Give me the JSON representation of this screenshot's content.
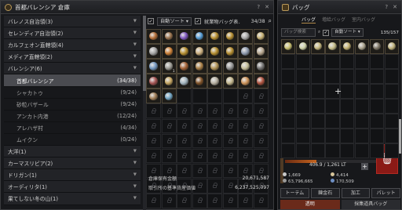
{
  "storage": {
    "title": "首都バレンシア 倉庫",
    "regions": [
      {
        "name": "バレノス自治領(3)",
        "type": "group"
      },
      {
        "name": "セレンディア自治領(2)",
        "type": "group"
      },
      {
        "name": "カルフェオン直轄領(4)",
        "type": "group"
      },
      {
        "name": "メディア直轄領(2)",
        "type": "group"
      },
      {
        "name": "バレンシア(6)",
        "type": "group"
      },
      {
        "name": "首都バレンシア",
        "count": "(34/38)",
        "type": "sub",
        "selected": true
      },
      {
        "name": "シャカトゥ",
        "count": "(9/24)",
        "type": "sub"
      },
      {
        "name": "砂粒バザール",
        "count": "(9/24)",
        "type": "sub"
      },
      {
        "name": "アンカト内港",
        "count": "(12/24)",
        "type": "sub"
      },
      {
        "name": "アレハザ村",
        "count": "(4/34)",
        "type": "sub"
      },
      {
        "name": "ムイクン",
        "count": "(0/24)",
        "type": "sub"
      },
      {
        "name": "大洋(1)",
        "type": "group"
      },
      {
        "name": "カーマスリビア(2)",
        "type": "group"
      },
      {
        "name": "ドリガン(1)",
        "type": "group"
      },
      {
        "name": "オーディリタ(1)",
        "type": "group"
      },
      {
        "name": "果てしない冬の山(1)",
        "type": "group"
      }
    ],
    "auto_sort_label": "自動ソート",
    "second_filter_label": "就業物バッグ表...",
    "capacity": "34/38",
    "item_colors": [
      "#c3773c",
      "#a77c53",
      "#8a5fd1",
      "#5aa9e8",
      "#c79b33",
      "#c79b33",
      "#b7b7b7",
      "#d9c27f",
      "#b4b4b4",
      "#e08b3a",
      "#c79b33",
      "#e0c08a",
      "#c79b33",
      "#c79b33",
      "#9aa7bd",
      "#c9b79d",
      "#7ca3d1",
      "#aaa9a2",
      "#b46a3a",
      "#b98a4b",
      "#c1a05e",
      "#a3a3a3",
      "#d6cfa8",
      "#7e7e7e",
      "#b35a5a",
      "#d8b56a",
      "#b0c4d0",
      "#8c5a2b",
      "#c7c0b0",
      "#d7c99c",
      "#e0a060",
      "#c15b45",
      "#b08a60",
      "#7ab2d4"
    ],
    "item_counts": [
      "",
      "",
      "",
      "",
      "",
      "",
      "",
      "",
      "",
      "",
      "",
      "",
      "",
      "",
      "",
      "",
      "",
      "1",
      "",
      "",
      "",
      "",
      "",
      "",
      "",
      "",
      "",
      "",
      "",
      "",
      "",
      "",
      "",
      ""
    ],
    "money_rows": [
      {
        "label": "倉庫保有金額",
        "value": "20,671,587"
      },
      {
        "label": "取引所の基準貨産価値",
        "value": "6,237,525,097"
      }
    ]
  },
  "bag": {
    "title": "バッグ",
    "tabs": [
      "バッグ",
      "増給バッグ",
      "室内バッグ"
    ],
    "search_placeholder": "バッグ検索",
    "auto_sort_label": "自動ソート",
    "capacity": "135/157",
    "item_colors": [
      "#dcd27a",
      "#e2e6b8",
      "#d9c98a",
      "#d8cf96",
      "#d6c27a",
      "#b9b19b",
      "#8a8170",
      "#d2c48a"
    ],
    "weight": "406.9 / 1,261 LT",
    "weight_percent": 32,
    "stats": [
      {
        "icon": "silver-coin-icon",
        "value": "1,669"
      },
      {
        "icon": "pearl-icon",
        "value": "4,414"
      },
      {
        "icon": "silver-icon",
        "value": "63,796,665"
      },
      {
        "icon": "mileage-icon",
        "value": "170,509"
      }
    ],
    "buttons": [
      "トーテム",
      "錬金石",
      "加工",
      "パレット"
    ],
    "bottom_tabs": [
      "透明",
      "採集道具バッグ"
    ]
  }
}
